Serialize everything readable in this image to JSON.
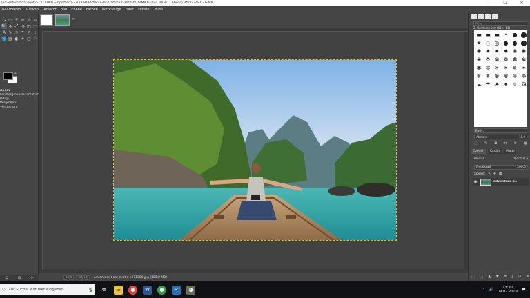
{
  "window": {
    "title": "[adventure-boat-exotic-1371380] (importiert)-2.0 (RGB-Farben 8-Bit-Gamma-Ganzzahl, GIMP built-in sRGB, 1 Ebene) 3472x2481 – GIMP",
    "minimize": "—",
    "maximize": "☐",
    "close": "✕"
  },
  "menubar": [
    "Bearbeiten",
    "Auswahl",
    "Ansicht",
    "Bild",
    "Ebene",
    "Farben",
    "Werkzeuge",
    "Filter",
    "Fenster",
    "Hilfe"
  ],
  "toolbox": {
    "tools": [
      "⤡",
      "▭",
      "⌾",
      "✂",
      "⟡",
      "⊹",
      "🔍",
      "✥",
      "⤢",
      "⟲",
      "◰",
      "⬚",
      "A",
      "✎",
      "▯",
      "⌖",
      "✐",
      "⌇",
      "🪣",
      "▤",
      "◐",
      "✦",
      "▢",
      "⛆"
    ],
    "options": {
      "title": "Zoom",
      "line1": "Fenstergröße automatisch anpass",
      "line2": "(Strg)",
      "line3": "Vergrößern",
      "line4": "Verkleinern"
    },
    "bottom_icons": [
      "⟲",
      "⊟",
      "⟳"
    ]
  },
  "image_tabs": {
    "close_glyph": "×"
  },
  "statusbar": {
    "unit": "px ▾",
    "zoom": "12,1 ▾",
    "message": "adventure-boat-exotic-1371380.jpg (180,0 MB)"
  },
  "dock": {
    "filter_placeholder": "Filter",
    "brush_name": "2. Hardness 050 (51 × 51)",
    "brush_tag": "Basic,",
    "spacing_label": "Abstand",
    "spacing_value": "10,0",
    "brush_actions": [
      "⬚",
      "✎",
      "⧉",
      "✕",
      "⟳",
      "▦"
    ],
    "layer_tabs": [
      "Ebenen",
      "Kanäle",
      "Pfade"
    ],
    "mode_label": "Modus",
    "mode_value": "Normal ▾",
    "opacity_label": "Deckkraft",
    "opacity_value": "100,0",
    "lock_label": "Sperre:",
    "layer_name": "adventure-bo",
    "bottom_icons": [
      "⬚",
      "⬚",
      "▲",
      "▼",
      "⧉",
      "⤓",
      "⊞",
      "✕"
    ]
  },
  "brushes": [
    "▬",
    "▬",
    "▬",
    "•",
    "●",
    "⬤",
    "★",
    "◌",
    "◎",
    "●",
    "●",
    "⬤",
    "✺",
    "✹",
    "✷",
    "✸",
    "❋",
    "✺",
    "❀",
    "✿",
    "✾",
    "❁",
    "✽",
    "❃",
    "✱",
    "✲",
    "✳",
    "✴",
    "✵",
    "✶",
    "❄",
    "❅",
    "❆",
    "❇",
    "❈",
    "❉",
    "☁",
    "☂",
    "☀",
    "✦",
    "✧",
    "✪"
  ],
  "taskbar": {
    "search_placeholder": "Zur Suche Text hier eingeben",
    "time": "13:30",
    "date": "09.07.2019",
    "tray_icons": [
      "⌃",
      "🔊",
      "💬"
    ]
  },
  "colors": {
    "fg": "#000000",
    "bg": "#ffffff",
    "canvas_bg": "#424242",
    "chrome": "#454545"
  }
}
